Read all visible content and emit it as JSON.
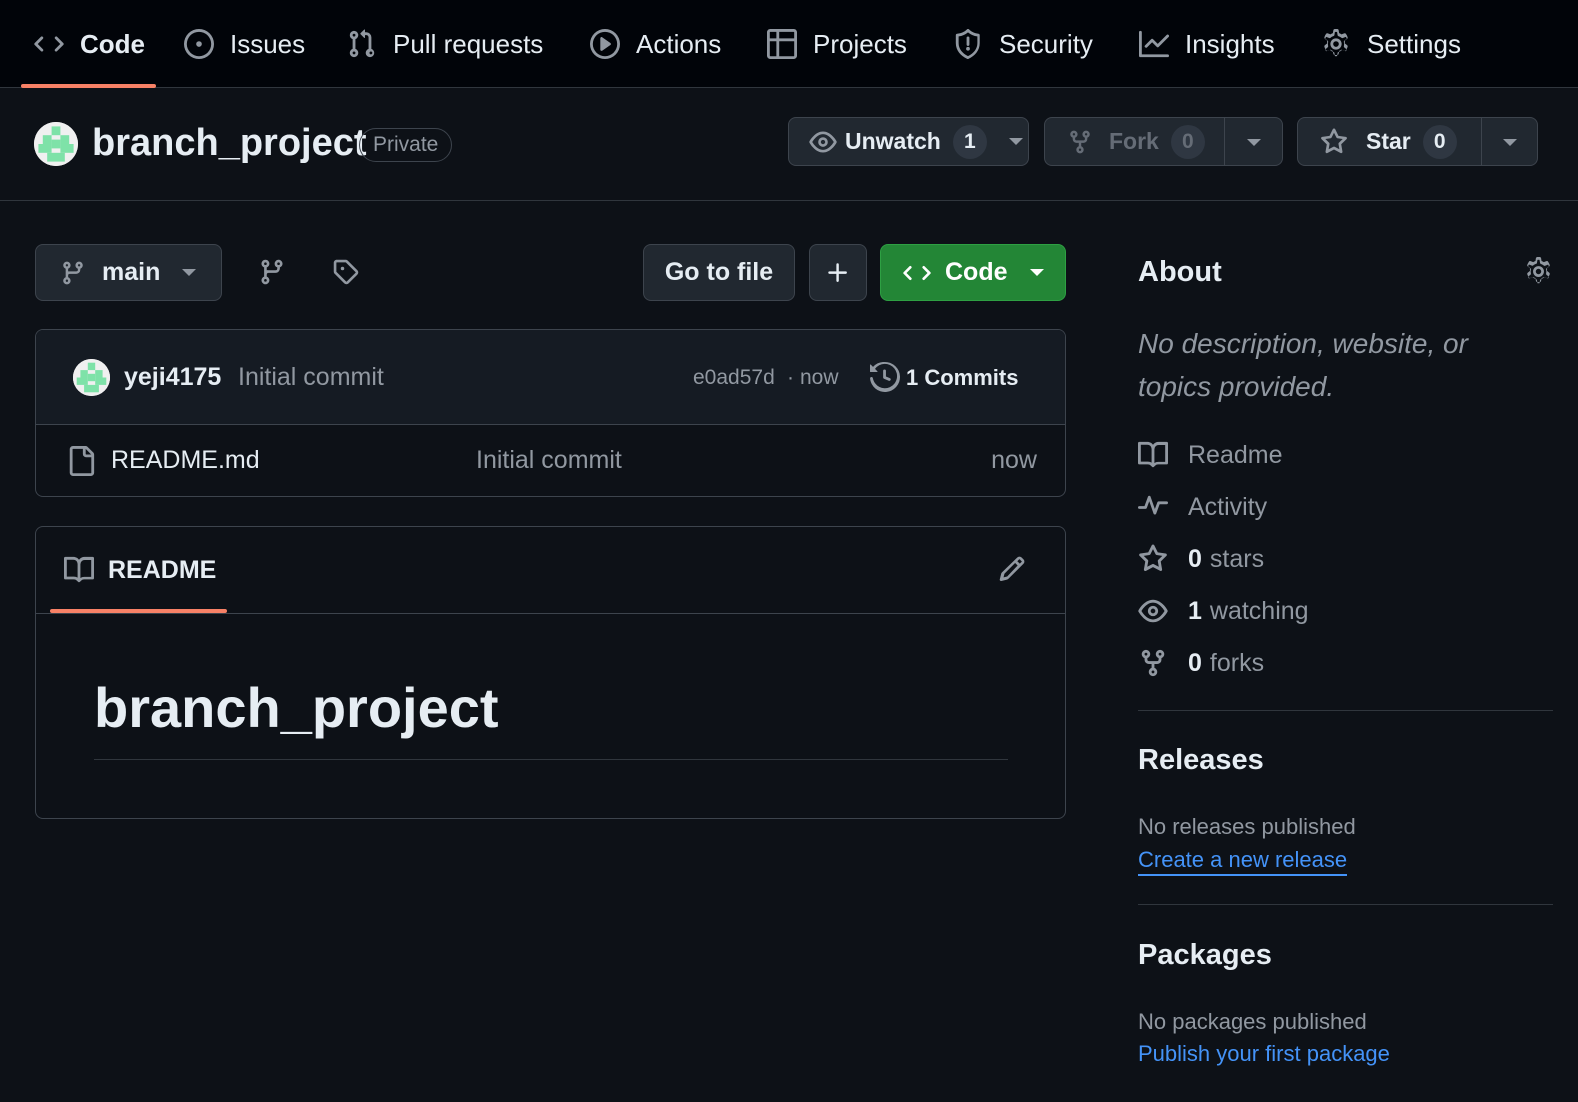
{
  "nav": {
    "tabs": [
      {
        "label": "Code",
        "icon": "code-icon"
      },
      {
        "label": "Issues",
        "icon": "issue-icon"
      },
      {
        "label": "Pull requests",
        "icon": "pull-request-icon"
      },
      {
        "label": "Actions",
        "icon": "play-icon"
      },
      {
        "label": "Projects",
        "icon": "table-icon"
      },
      {
        "label": "Security",
        "icon": "shield-icon"
      },
      {
        "label": "Insights",
        "icon": "graph-icon"
      },
      {
        "label": "Settings",
        "icon": "gear-icon"
      }
    ],
    "active_tab": "Code"
  },
  "repo": {
    "name": "branch_project",
    "visibility": "Private",
    "unwatch_label": "Unwatch",
    "watch_count": "1",
    "fork_label": "Fork",
    "fork_count": "0",
    "star_label": "Star",
    "star_count": "0"
  },
  "toolbar": {
    "branch": "main",
    "go_to_file": "Go to file",
    "add": "+",
    "code_button": "Code"
  },
  "commit": {
    "author": "yeji4175",
    "message": "Initial commit",
    "hash": "e0ad57d",
    "time": "now",
    "separator": "·",
    "commits_label": "1 Commits"
  },
  "files": [
    {
      "name": "README.md",
      "message": "Initial commit",
      "time": "now"
    }
  ],
  "readme": {
    "tab_label": "README",
    "heading": "branch_project"
  },
  "about": {
    "title": "About",
    "description": "No description, website, or topics provided.",
    "readme": "Readme",
    "activity": "Activity",
    "stars_count": "0",
    "stars_label": "stars",
    "watching_count": "1",
    "watching_label": "watching",
    "forks_count": "0",
    "forks_label": "forks"
  },
  "releases": {
    "title": "Releases",
    "empty": "No releases published",
    "link": "Create a new release"
  },
  "packages": {
    "title": "Packages",
    "empty": "No packages published",
    "link": "Publish your first package"
  },
  "colors": {
    "background": "#0d1117",
    "nav_background": "#010409",
    "accent_underline": "#f78166",
    "code_button": "#238636",
    "link": "#4493f8",
    "avatar_green": "#7ee2a8"
  }
}
